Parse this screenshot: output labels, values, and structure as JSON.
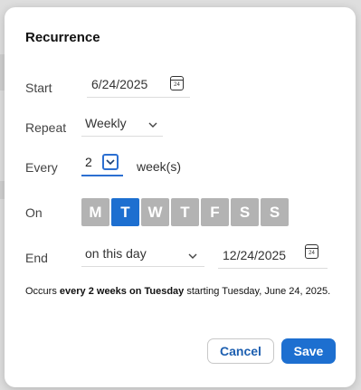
{
  "dialog": {
    "title": "Recurrence"
  },
  "start": {
    "label": "Start",
    "date": "6/24/2025",
    "calendar_day": "24"
  },
  "repeat": {
    "label": "Repeat",
    "value": "Weekly"
  },
  "every": {
    "label": "Every",
    "value": "2",
    "unit": "week(s)"
  },
  "on": {
    "label": "On",
    "days": [
      {
        "letter": "M",
        "selected": false
      },
      {
        "letter": "T",
        "selected": true
      },
      {
        "letter": "W",
        "selected": false
      },
      {
        "letter": "T",
        "selected": false
      },
      {
        "letter": "F",
        "selected": false
      },
      {
        "letter": "S",
        "selected": false
      },
      {
        "letter": "S",
        "selected": false
      }
    ]
  },
  "end": {
    "label": "End",
    "mode": "on this day",
    "date": "12/24/2025",
    "calendar_day": "24"
  },
  "summary": {
    "prefix": "Occurs ",
    "bold": "every 2 weeks on Tuesday",
    "suffix": " starting Tuesday, June 24, 2025."
  },
  "buttons": {
    "cancel": "Cancel",
    "save": "Save"
  },
  "colors": {
    "accent": "#1d6fd0",
    "day_unselected": "#b3b3b3"
  }
}
